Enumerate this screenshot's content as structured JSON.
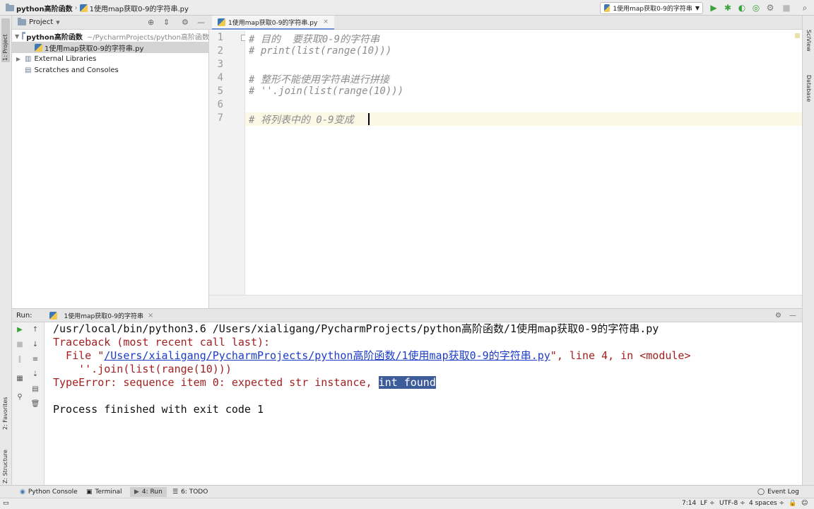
{
  "navbar": {
    "project_name": "python高阶函数",
    "file_name": "1使用map获取0-9的字符串.py",
    "run_config": "1使用map获取0-9的字符串"
  },
  "left_strip": {
    "project_tab": "1: Project",
    "favorites_tab": "2: Favorites",
    "structure_tab": "Z: Structure"
  },
  "right_strip": {
    "sciview_tab": "SciView",
    "database_tab": "Database"
  },
  "project_panel": {
    "title": "Project",
    "tree": [
      {
        "label": "python高阶函数",
        "path": "~/PycharmProjects/python高阶函数"
      },
      {
        "label": "1使用map获取0-9的字符串.py"
      },
      {
        "label": "External Libraries"
      },
      {
        "label": "Scratches and Consoles"
      }
    ]
  },
  "editor": {
    "tab_label": "1使用map获取0-9的字符串.py",
    "lines": [
      {
        "num": "1",
        "text": "# 目的  要获取0-9的字符串"
      },
      {
        "num": "2",
        "text": "# print(list(range(10)))"
      },
      {
        "num": "3",
        "text": ""
      },
      {
        "num": "4",
        "text": "# 整形不能使用字符串进行拼接"
      },
      {
        "num": "5",
        "text": "# ''.join(list(range(10)))"
      },
      {
        "num": "6",
        "text": ""
      },
      {
        "num": "7",
        "text": "# 将列表中的 0-9变成"
      }
    ]
  },
  "run_panel": {
    "title": "Run:",
    "tab_label": "1使用map获取0-9的字符串",
    "console": {
      "cmd": "/usr/local/bin/python3.6 /Users/xialigang/PycharmProjects/python高阶函数/1使用map获取0-9的字符串.py",
      "traceback": "Traceback (most recent call last):",
      "file_prefix": "  File \"",
      "file_link": "/Users/xialigang/PycharmProjects/python高阶函数/1使用map获取0-9的字符串.py",
      "file_suffix": "\", line 4, in <module>",
      "code_line": "    ''.join(list(range(10)))",
      "error_prefix": "TypeError: sequence item 0: expected str instance, ",
      "error_highlight": "int found",
      "finished": "Process finished with exit code 1"
    }
  },
  "bottom_tabs": {
    "python_console": "Python Console",
    "terminal": "Terminal",
    "run": "4: Run",
    "todo": "6: TODO",
    "event_log": "Event Log"
  },
  "status_bar": {
    "position": "7:14",
    "line_sep": "LF ÷",
    "encoding": "UTF-8 ÷",
    "indent": "4 spaces ÷"
  }
}
